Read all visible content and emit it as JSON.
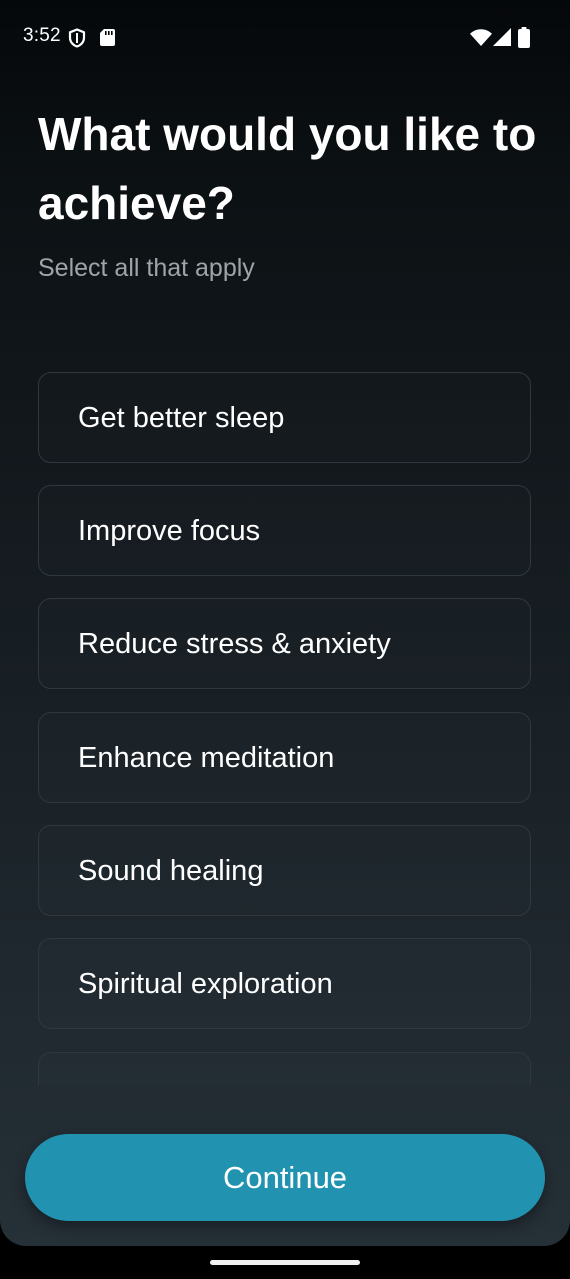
{
  "status_bar": {
    "time": "3:52",
    "icons": [
      "shield-icon",
      "sd-card-icon",
      "wifi-icon",
      "cell-signal-icon",
      "battery-icon"
    ]
  },
  "header": {
    "title": "What would you like to achieve?",
    "subtitle": "Select all that apply"
  },
  "options": [
    {
      "label": "Get better sleep"
    },
    {
      "label": "Improve focus"
    },
    {
      "label": "Reduce stress & anxiety"
    },
    {
      "label": "Enhance meditation"
    },
    {
      "label": "Sound healing"
    },
    {
      "label": "Spiritual exploration"
    },
    {
      "label": ""
    }
  ],
  "footer": {
    "continue_label": "Continue"
  },
  "colors": {
    "accent": "#2193b0",
    "background_top": "#05080a",
    "background_bottom": "#253037",
    "option_border": "#2f383e",
    "subtitle": "#9ea5aa"
  }
}
